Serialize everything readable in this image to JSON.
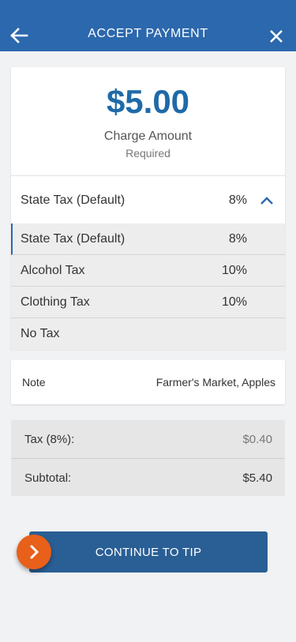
{
  "header": {
    "title": "ACCEPT PAYMENT",
    "back_icon": "arrow-left-icon",
    "close_icon": "close-icon",
    "bg_color": "#2c68ad"
  },
  "amount": {
    "value": "$5.00",
    "label": "Charge Amount",
    "sublabel": "Required",
    "color": "#1f6aa8"
  },
  "tax": {
    "selected": {
      "name": "State Tax (Default)",
      "rate": "8%"
    },
    "options": [
      {
        "name": "State Tax (Default)",
        "rate": "8%"
      },
      {
        "name": "Alcohol Tax",
        "rate": "10%"
      },
      {
        "name": "Clothing Tax",
        "rate": "10%"
      },
      {
        "name": "No Tax",
        "rate": ""
      }
    ]
  },
  "note": {
    "label": "Note",
    "value": "Farmer's Market, Apples"
  },
  "summary": {
    "tax_label": "Tax (8%):",
    "tax_value": "$0.40",
    "subtotal_label": "Subtotal:",
    "subtotal_value": "$5.40"
  },
  "continue": {
    "label": "CONTINUE TO TIP",
    "fab_icon": "chevron-right-icon",
    "fab_color": "#e8601a"
  }
}
